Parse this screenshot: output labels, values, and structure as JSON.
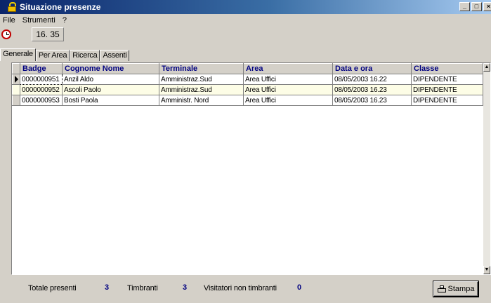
{
  "window": {
    "title": "Situazione presenze"
  },
  "menu": [
    "File",
    "Strumenti",
    "?"
  ],
  "toolbar": {
    "time": "16. 35"
  },
  "tabs": [
    "Generale",
    "Per Area",
    "Ricerca",
    "Assenti"
  ],
  "grid": {
    "columns": [
      "Badge",
      "Cognome Nome",
      "Terminale",
      "Area",
      "Data e ora",
      "Classe"
    ],
    "rows": [
      [
        "0000000951",
        "Anzil Aldo",
        "Amministraz.Sud",
        "Area Uffici",
        "08/05/2003 16.22",
        "DIPENDENTE"
      ],
      [
        "0000000952",
        "Ascoli Paolo",
        "Amministraz.Sud",
        "Area Uffici",
        "08/05/2003 16.23",
        "DIPENDENTE"
      ],
      [
        "0000000953",
        "Bosti Paola",
        "Amministr. Nord",
        "Area Uffici",
        "08/05/2003 16.23",
        "DIPENDENTE"
      ]
    ]
  },
  "status": {
    "totale_label": "Totale presenti",
    "totale_value": "3",
    "timbranti_label": "Timbranti",
    "timbranti_value": "3",
    "visitatori_label": "Visitatori non timbranti",
    "visitatori_value": "0"
  },
  "print_button": {
    "label": "Stampa"
  }
}
